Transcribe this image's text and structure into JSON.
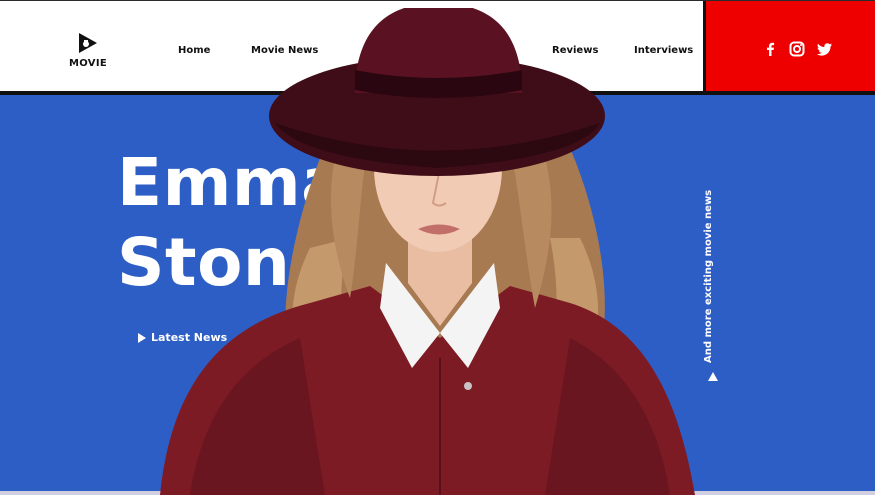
{
  "logo": {
    "text": "MOVIE",
    "icon": "play-icon"
  },
  "nav": {
    "home": "Home",
    "movie_news": "Movie News",
    "reviews": "Reviews",
    "interviews": "Interviews"
  },
  "social": {
    "items": [
      "facebook-icon",
      "instagram-icon",
      "twitter-icon"
    ]
  },
  "hero": {
    "title_line1": "Emma",
    "title_line2": "Stone",
    "latest_news": "Latest News",
    "vertical_text": "And more exciting movie news"
  },
  "colors": {
    "hero_blue": "#2d5ec6",
    "social_red": "#ee0000",
    "hat_burgundy": "#5a1222",
    "coat_red": "#7d1b24",
    "text_white": "#ffffff"
  }
}
